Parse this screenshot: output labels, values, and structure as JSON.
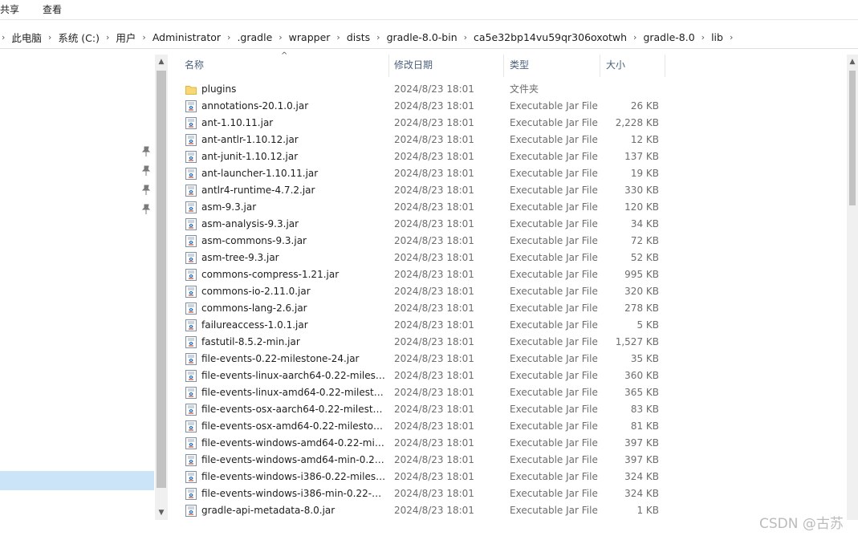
{
  "ribbon": {
    "tabs": [
      "共享",
      "查看"
    ]
  },
  "breadcrumb": [
    "此电脑",
    "系统 (C:)",
    "用户",
    "Administrator",
    ".gradle",
    "wrapper",
    "dists",
    "gradle-8.0-bin",
    "ca5e32bp14vu59qr306oxotwh",
    "gradle-8.0",
    "lib"
  ],
  "columns": {
    "name": "名称",
    "date": "修改日期",
    "type": "类型",
    "size": "大小"
  },
  "files": [
    {
      "name": "plugins",
      "date": "2024/8/23 18:01",
      "type": "文件夹",
      "size": "",
      "icon": "folder-icon"
    },
    {
      "name": "annotations-20.1.0.jar",
      "date": "2024/8/23 18:01",
      "type": "Executable Jar File",
      "size": "26 KB",
      "icon": "jar-file-icon"
    },
    {
      "name": "ant-1.10.11.jar",
      "date": "2024/8/23 18:01",
      "type": "Executable Jar File",
      "size": "2,228 KB",
      "icon": "jar-file-icon"
    },
    {
      "name": "ant-antlr-1.10.12.jar",
      "date": "2024/8/23 18:01",
      "type": "Executable Jar File",
      "size": "12 KB",
      "icon": "jar-file-icon"
    },
    {
      "name": "ant-junit-1.10.12.jar",
      "date": "2024/8/23 18:01",
      "type": "Executable Jar File",
      "size": "137 KB",
      "icon": "jar-file-icon"
    },
    {
      "name": "ant-launcher-1.10.11.jar",
      "date": "2024/8/23 18:01",
      "type": "Executable Jar File",
      "size": "19 KB",
      "icon": "jar-file-icon"
    },
    {
      "name": "antlr4-runtime-4.7.2.jar",
      "date": "2024/8/23 18:01",
      "type": "Executable Jar File",
      "size": "330 KB",
      "icon": "jar-file-icon"
    },
    {
      "name": "asm-9.3.jar",
      "date": "2024/8/23 18:01",
      "type": "Executable Jar File",
      "size": "120 KB",
      "icon": "jar-file-icon"
    },
    {
      "name": "asm-analysis-9.3.jar",
      "date": "2024/8/23 18:01",
      "type": "Executable Jar File",
      "size": "34 KB",
      "icon": "jar-file-icon"
    },
    {
      "name": "asm-commons-9.3.jar",
      "date": "2024/8/23 18:01",
      "type": "Executable Jar File",
      "size": "72 KB",
      "icon": "jar-file-icon"
    },
    {
      "name": "asm-tree-9.3.jar",
      "date": "2024/8/23 18:01",
      "type": "Executable Jar File",
      "size": "52 KB",
      "icon": "jar-file-icon"
    },
    {
      "name": "commons-compress-1.21.jar",
      "date": "2024/8/23 18:01",
      "type": "Executable Jar File",
      "size": "995 KB",
      "icon": "jar-file-icon"
    },
    {
      "name": "commons-io-2.11.0.jar",
      "date": "2024/8/23 18:01",
      "type": "Executable Jar File",
      "size": "320 KB",
      "icon": "jar-file-icon"
    },
    {
      "name": "commons-lang-2.6.jar",
      "date": "2024/8/23 18:01",
      "type": "Executable Jar File",
      "size": "278 KB",
      "icon": "jar-file-icon"
    },
    {
      "name": "failureaccess-1.0.1.jar",
      "date": "2024/8/23 18:01",
      "type": "Executable Jar File",
      "size": "5 KB",
      "icon": "jar-file-icon"
    },
    {
      "name": "fastutil-8.5.2-min.jar",
      "date": "2024/8/23 18:01",
      "type": "Executable Jar File",
      "size": "1,527 KB",
      "icon": "jar-file-icon"
    },
    {
      "name": "file-events-0.22-milestone-24.jar",
      "date": "2024/8/23 18:01",
      "type": "Executable Jar File",
      "size": "35 KB",
      "icon": "jar-file-icon"
    },
    {
      "name": "file-events-linux-aarch64-0.22-milesto...",
      "date": "2024/8/23 18:01",
      "type": "Executable Jar File",
      "size": "360 KB",
      "icon": "jar-file-icon"
    },
    {
      "name": "file-events-linux-amd64-0.22-milesto...",
      "date": "2024/8/23 18:01",
      "type": "Executable Jar File",
      "size": "365 KB",
      "icon": "jar-file-icon"
    },
    {
      "name": "file-events-osx-aarch64-0.22-milesto...",
      "date": "2024/8/23 18:01",
      "type": "Executable Jar File",
      "size": "83 KB",
      "icon": "jar-file-icon"
    },
    {
      "name": "file-events-osx-amd64-0.22-mileston...",
      "date": "2024/8/23 18:01",
      "type": "Executable Jar File",
      "size": "81 KB",
      "icon": "jar-file-icon"
    },
    {
      "name": "file-events-windows-amd64-0.22-mile...",
      "date": "2024/8/23 18:01",
      "type": "Executable Jar File",
      "size": "397 KB",
      "icon": "jar-file-icon"
    },
    {
      "name": "file-events-windows-amd64-min-0.22...",
      "date": "2024/8/23 18:01",
      "type": "Executable Jar File",
      "size": "397 KB",
      "icon": "jar-file-icon"
    },
    {
      "name": "file-events-windows-i386-0.22-milest...",
      "date": "2024/8/23 18:01",
      "type": "Executable Jar File",
      "size": "324 KB",
      "icon": "jar-file-icon"
    },
    {
      "name": "file-events-windows-i386-min-0.22-mi...",
      "date": "2024/8/23 18:01",
      "type": "Executable Jar File",
      "size": "324 KB",
      "icon": "jar-file-icon"
    },
    {
      "name": "gradle-api-metadata-8.0.jar",
      "date": "2024/8/23 18:01",
      "type": "Executable Jar File",
      "size": "1 KB",
      "icon": "jar-file-icon"
    }
  ],
  "watermark": "CSDN @古苏",
  "colors": {
    "folder": "#f8d775",
    "selection": "#cce4f7",
    "header_text": "#4c607a",
    "muted_text": "#6d6d6d"
  }
}
